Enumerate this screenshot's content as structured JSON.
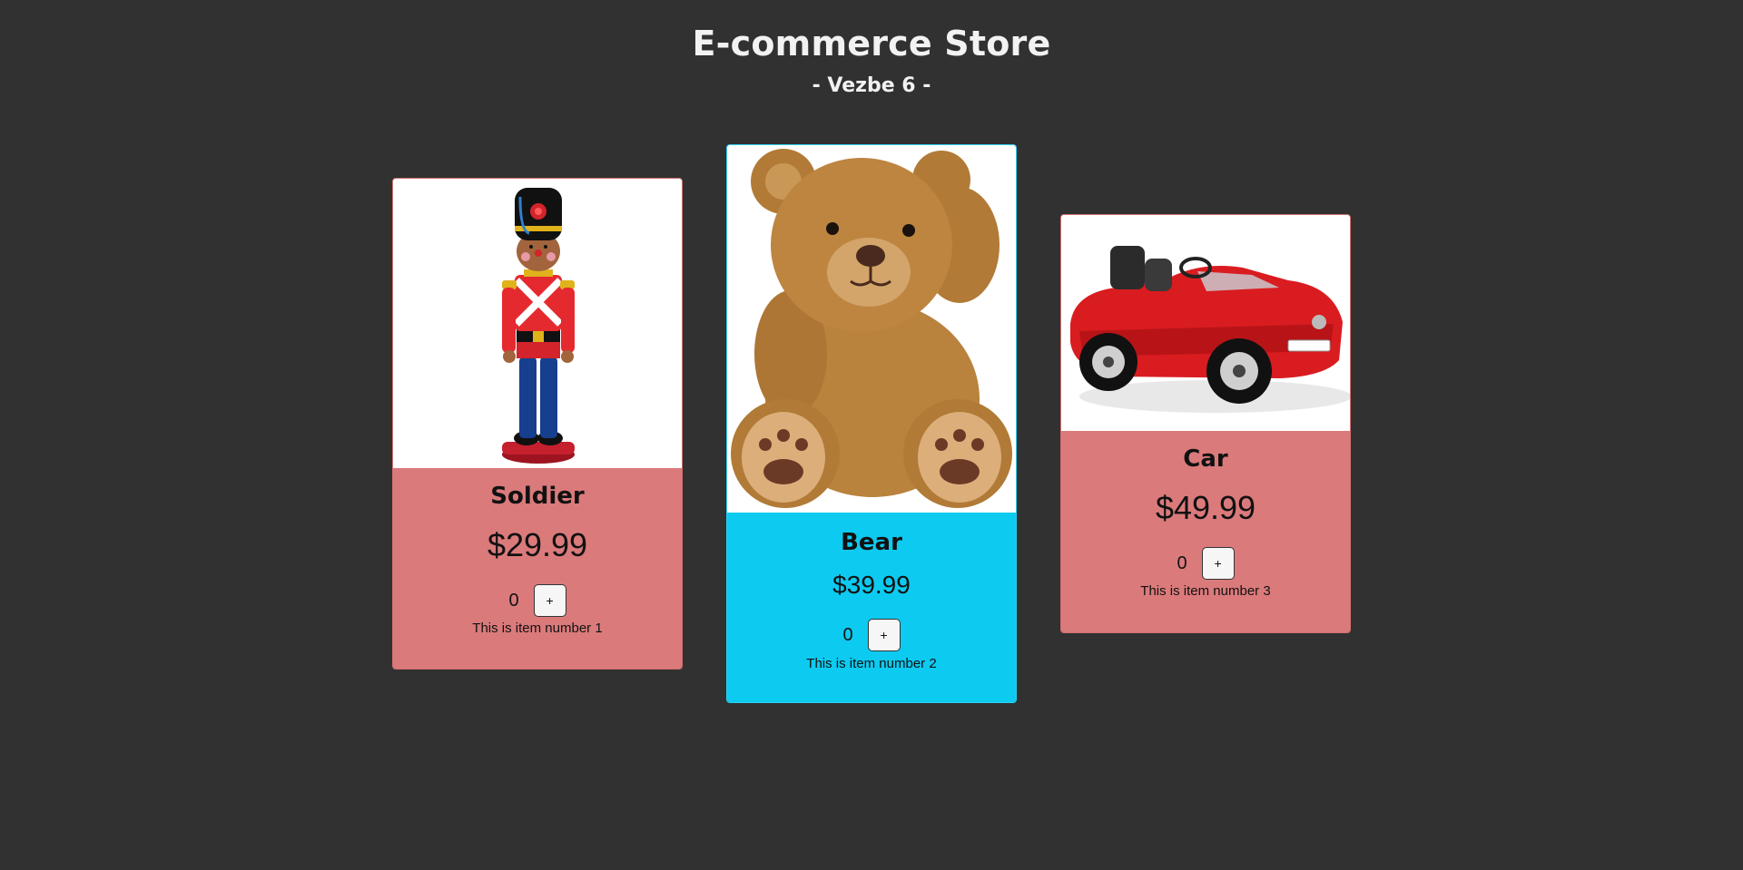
{
  "header": {
    "title": "E-commerce Store",
    "subtitle": "- Vezbe 6 -"
  },
  "products": [
    {
      "name": "Soldier",
      "price": "$29.99",
      "count": "0",
      "add_label": "+",
      "description": "This is item number 1",
      "image_icon": "toy-soldier-image",
      "color": "#db7a7b"
    },
    {
      "name": "Bear",
      "price": "$39.99",
      "count": "0",
      "add_label": "+",
      "description": "This is item number 2",
      "image_icon": "teddy-bear-image",
      "color": "#0dcaf0"
    },
    {
      "name": "Car",
      "price": "$49.99",
      "count": "0",
      "add_label": "+",
      "description": "This is item number 3",
      "image_icon": "red-toy-car-image",
      "color": "#db7a7b"
    }
  ]
}
